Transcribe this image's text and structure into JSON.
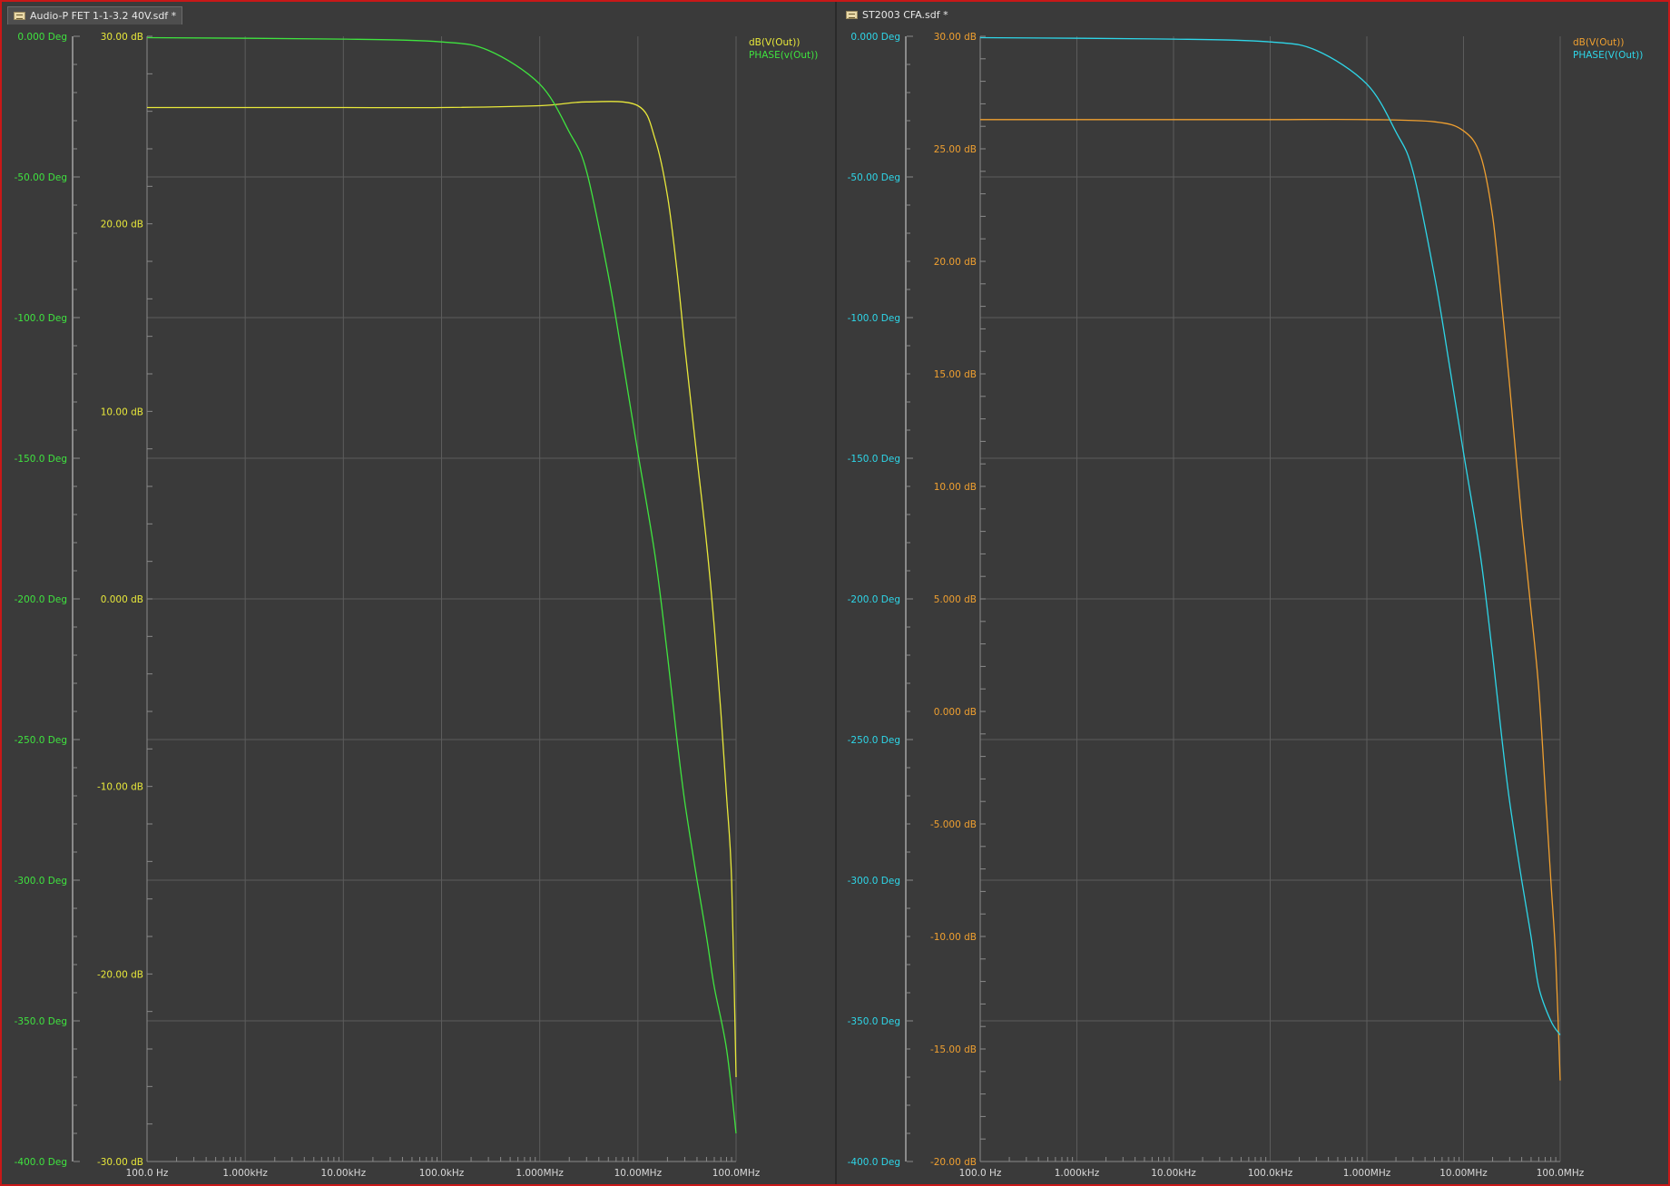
{
  "tabs": [
    {
      "label": "Audio-P FET 1-1-3.2 40V.sdf *",
      "active": true
    },
    {
      "label": "ST2003 CFA.sdf *",
      "active": false
    }
  ],
  "colors": {
    "background": "#3a3a3a",
    "grid": "#5c5c5c",
    "axis": "#8a8a8a",
    "xtick": "#d8d8d8",
    "frame": "#c81818"
  },
  "chart_data": [
    {
      "type": "line",
      "x_scale": "log",
      "xlim": [
        100,
        100000000
      ],
      "x_ticks": [
        100,
        1000,
        10000,
        100000,
        1000000,
        10000000,
        100000000
      ],
      "x_tick_labels": [
        "100.0 Hz",
        "1.000kHz",
        "10.00kHz",
        "100.0kHz",
        "1.000MHz",
        "10.00MHz",
        "100.0MHz"
      ],
      "phase_axis": {
        "ylim": [
          -400,
          0
        ],
        "ticks": [
          0,
          -50,
          -100,
          -150,
          -200,
          -250,
          -300,
          -350,
          -400
        ],
        "tick_labels": [
          "0.000 Deg",
          "-50.00 Deg",
          "-100.0 Deg",
          "-150.0 Deg",
          "-200.0 Deg",
          "-250.0 Deg",
          "-300.0 Deg",
          "-350.0 Deg",
          "-400.0 Deg"
        ],
        "color": "#3fe33f"
      },
      "db_axis": {
        "ylim": [
          -30,
          30
        ],
        "ticks": [
          30,
          20,
          10,
          0,
          -10,
          -20,
          -30
        ],
        "tick_labels": [
          "30.00 dB",
          "20.00 dB",
          "10.00 dB",
          "0.000 dB",
          "-10.00 dB",
          "-20.00 dB",
          "-30.00 dB"
        ],
        "color": "#e8e83a"
      },
      "legend_position": "top-right",
      "series": [
        {
          "name": "dB(V(Out))",
          "axis": "db",
          "color": "#e8e83a",
          "x": [
            100,
            1000,
            10000,
            100000,
            1000000,
            3000000,
            10000000,
            15000000,
            20000000,
            25000000,
            30000000,
            40000000,
            50000000,
            60000000,
            70000000,
            80000000,
            90000000,
            100000000
          ],
          "y": [
            26.2,
            26.2,
            26.2,
            26.2,
            26.3,
            26.5,
            26.3,
            24.5,
            21.5,
            17.5,
            13.5,
            7.5,
            3.0,
            -1.5,
            -6.0,
            -10.5,
            -15.0,
            -25.5
          ]
        },
        {
          "name": "PHASE(v(Out))",
          "axis": "phase",
          "color": "#3fe33f",
          "x": [
            100,
            10000,
            100000,
            300000,
            1000000,
            2000000,
            3000000,
            5000000,
            7000000,
            10000000,
            15000000,
            20000000,
            25000000,
            30000000,
            40000000,
            50000000,
            60000000,
            80000000,
            100000000
          ],
          "y": [
            -0.5,
            -1,
            -2,
            -5,
            -17,
            -34,
            -48,
            -85,
            -115,
            -148,
            -185,
            -220,
            -250,
            -272,
            -300,
            -320,
            -338,
            -360,
            -390
          ]
        }
      ]
    },
    {
      "type": "line",
      "x_scale": "log",
      "xlim": [
        100,
        100000000
      ],
      "x_ticks": [
        100,
        1000,
        10000,
        100000,
        1000000,
        10000000,
        100000000
      ],
      "x_tick_labels": [
        "100.0 Hz",
        "1.000kHz",
        "10.00kHz",
        "100.0kHz",
        "1.000MHz",
        "10.00MHz",
        "100.0MHz"
      ],
      "phase_axis": {
        "ylim": [
          -400,
          0
        ],
        "ticks": [
          0,
          -50,
          -100,
          -150,
          -200,
          -250,
          -300,
          -350,
          -400
        ],
        "tick_labels": [
          "0.000 Deg",
          "-50.00 Deg",
          "-100.0 Deg",
          "-150.0 Deg",
          "-200.0 Deg",
          "-250.0 Deg",
          "-300.0 Deg",
          "-350.0 Deg",
          "-400.0 Deg"
        ],
        "color": "#2ed6e8"
      },
      "db_axis": {
        "ylim": [
          -20,
          30
        ],
        "ticks": [
          30,
          25,
          20,
          15,
          10,
          5,
          0,
          -5,
          -10,
          -15,
          -20
        ],
        "tick_labels": [
          "30.00 dB",
          "25.00 dB",
          "20.00 dB",
          "15.00 dB",
          "10.00 dB",
          "5.000 dB",
          "0.000 dB",
          "-5.000 dB",
          "-10.00 dB",
          "-15.00 dB",
          "-20.00 dB"
        ],
        "color": "#f0a030"
      },
      "legend_position": "top-right",
      "series": [
        {
          "name": "dB(V(Out))",
          "axis": "db",
          "color": "#f0a030",
          "x": [
            100,
            1000,
            10000,
            100000,
            1000000,
            5000000,
            10000000,
            15000000,
            20000000,
            25000000,
            30000000,
            40000000,
            50000000,
            60000000,
            70000000,
            80000000,
            90000000,
            100000000
          ],
          "y": [
            26.3,
            26.3,
            26.3,
            26.3,
            26.3,
            26.2,
            25.8,
            24.7,
            22.0,
            18.0,
            14.5,
            8.5,
            4.5,
            1.0,
            -3.5,
            -7.5,
            -11.0,
            -16.4
          ]
        },
        {
          "name": "PHASE(V(Out))",
          "axis": "phase",
          "color": "#2ed6e8",
          "x": [
            100,
            10000,
            100000,
            300000,
            1000000,
            2000000,
            3000000,
            5000000,
            7000000,
            10000000,
            15000000,
            20000000,
            25000000,
            30000000,
            40000000,
            50000000,
            60000000,
            80000000,
            100000000
          ],
          "y": [
            -0.5,
            -1,
            -2,
            -5,
            -17,
            -34,
            -48,
            -85,
            -115,
            -148,
            -185,
            -220,
            -250,
            -272,
            -300,
            -320,
            -338,
            -350,
            -355
          ]
        }
      ]
    }
  ]
}
